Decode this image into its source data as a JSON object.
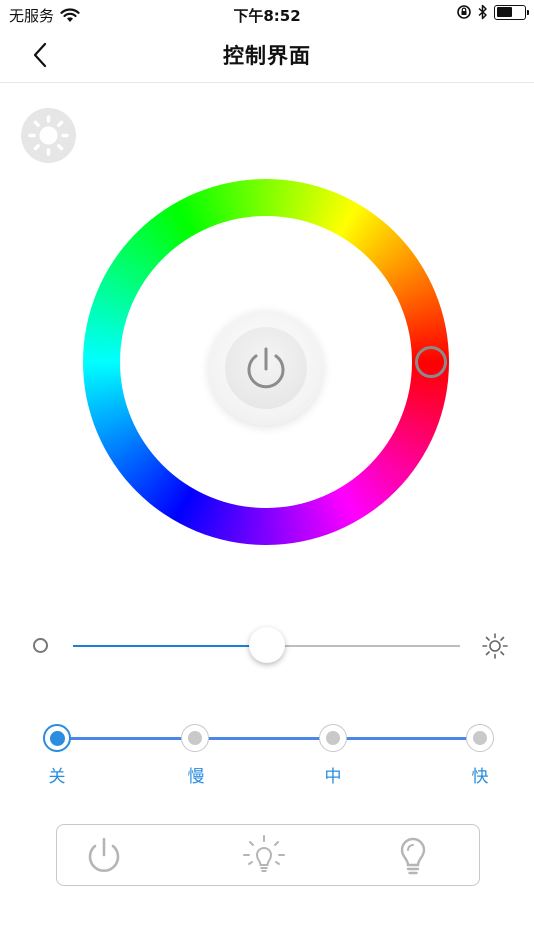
{
  "status_bar": {
    "carrier": "无服务",
    "time": "下午8:52",
    "battery_level": 0.6
  },
  "nav": {
    "title": "控制界面",
    "back_icon": "chevron-left-icon"
  },
  "light_toggle": {
    "icon": "sun-icon"
  },
  "color_wheel": {
    "icon": "power-icon",
    "selected_hue_deg": 0
  },
  "brightness": {
    "value": 0.5,
    "min_icon": "small-circle-icon",
    "max_icon": "sun-bright-icon",
    "fill_color": "#1e7fd9"
  },
  "speed": {
    "options": [
      "关",
      "慢",
      "中",
      "快"
    ],
    "selected_index": 0,
    "accent_color": "#2a8de0"
  },
  "toolbar": {
    "items": [
      "power-icon",
      "light-bulb-glow-icon",
      "light-bulb-icon"
    ]
  }
}
